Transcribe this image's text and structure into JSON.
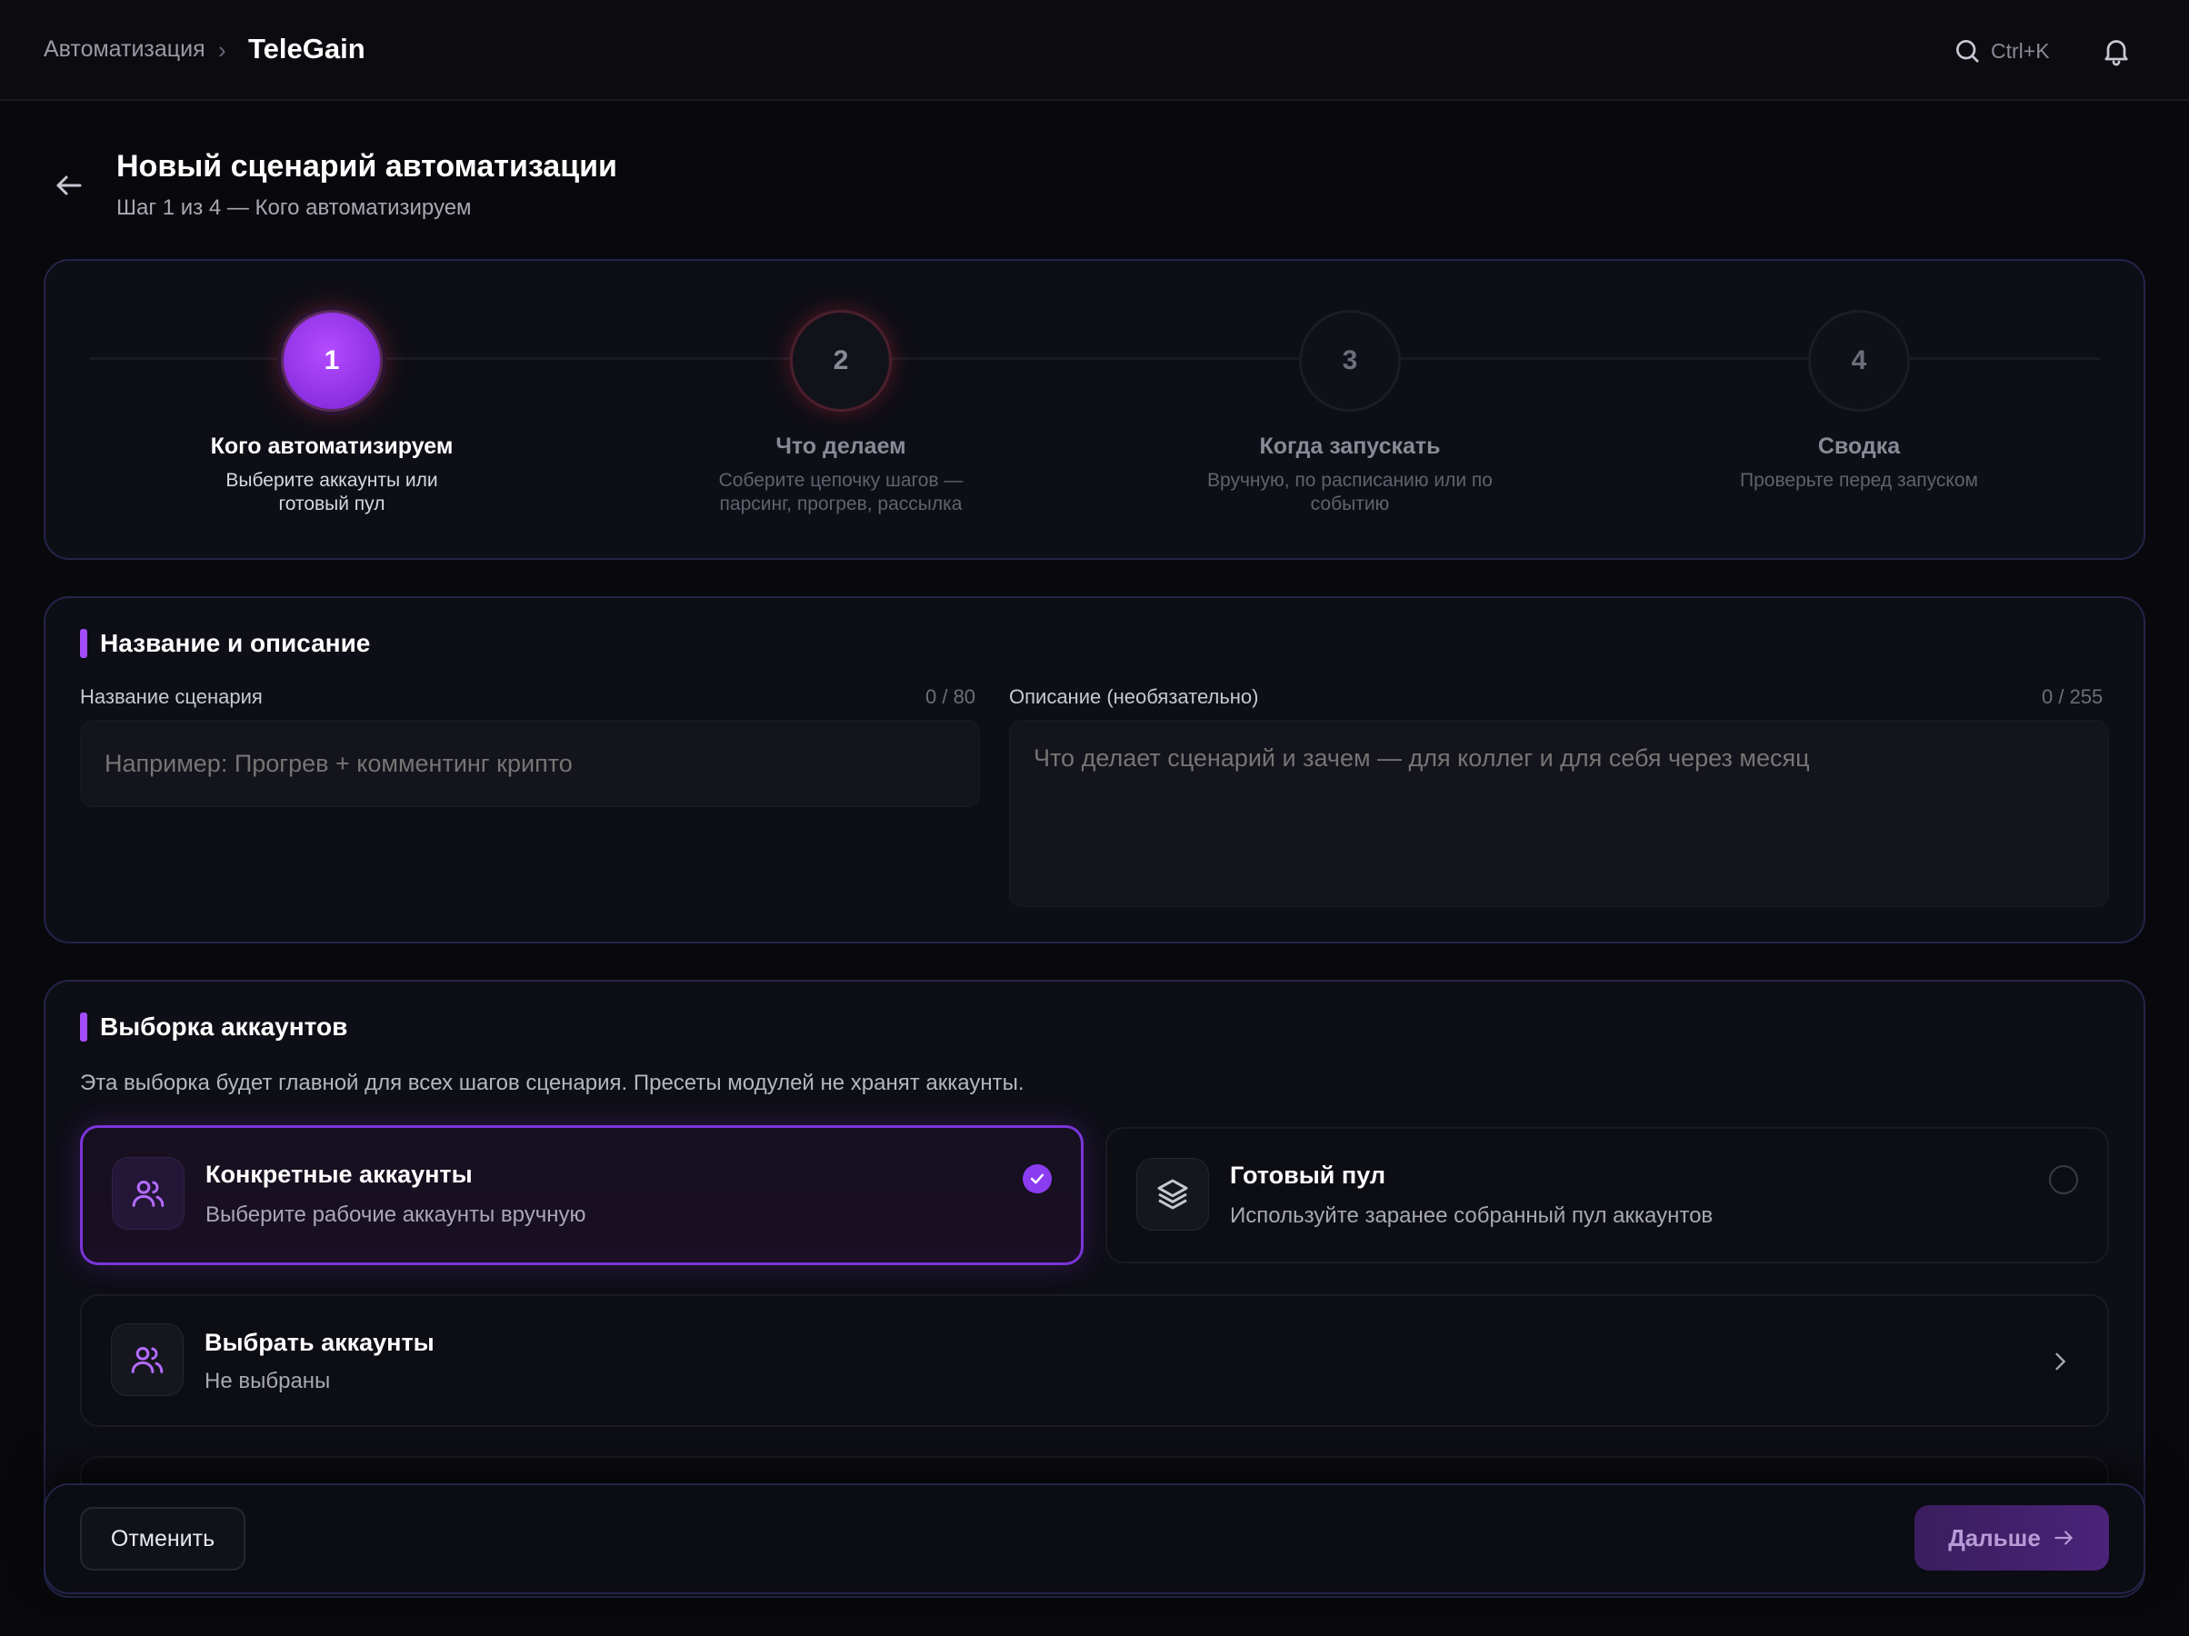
{
  "topbar": {
    "breadcrumb_root": "Автоматизация",
    "breadcrumb_sep": "›",
    "breadcrumb_current": "TeleGain",
    "search_shortcut": "Ctrl+K"
  },
  "header": {
    "title": "Новый сценарий автоматизации",
    "subtitle": "Шаг 1 из 4 — Кого автоматизируем"
  },
  "stepper": {
    "steps": [
      {
        "num": "1",
        "title": "Кого автоматизируем",
        "desc": "Выберите аккаунты или готовый пул",
        "state": "active"
      },
      {
        "num": "2",
        "title": "Что делаем",
        "desc": "Соберите цепочку шагов — парсинг, прогрев, рассылка",
        "state": "next"
      },
      {
        "num": "3",
        "title": "Когда запускать",
        "desc": "Вручную, по расписанию или по событию",
        "state": "idle"
      },
      {
        "num": "4",
        "title": "Сводка",
        "desc": "Проверьте перед запуском",
        "state": "idle"
      }
    ]
  },
  "name_section": {
    "title": "Название и описание",
    "name_label": "Название сценария",
    "name_counter": "0 / 80",
    "name_placeholder": "Например: Прогрев + комментинг крипто",
    "desc_label": "Описание (необязательно)",
    "desc_counter": "0 / 255",
    "desc_placeholder": "Что делает сценарий и зачем — для коллег и для себя через месяц"
  },
  "accounts_section": {
    "title": "Выборка аккаунтов",
    "hint": "Эта выборка будет главной для всех шагов сценария. Пресеты модулей не хранят аккаунты.",
    "option_specific": {
      "title": "Конкретные аккаунты",
      "desc": "Выберите рабочие аккаунты вручную"
    },
    "option_pool": {
      "title": "Готовый пул",
      "desc": "Используйте заранее собранный пул аккаунтов"
    },
    "select_row": {
      "title": "Выбрать аккаунты",
      "desc": "Не выбраны"
    }
  },
  "footer": {
    "cancel": "Отменить",
    "next": "Дальше"
  },
  "colors": {
    "accent": "#a24dff",
    "background": "#09090d",
    "card_border": "#24244a"
  }
}
